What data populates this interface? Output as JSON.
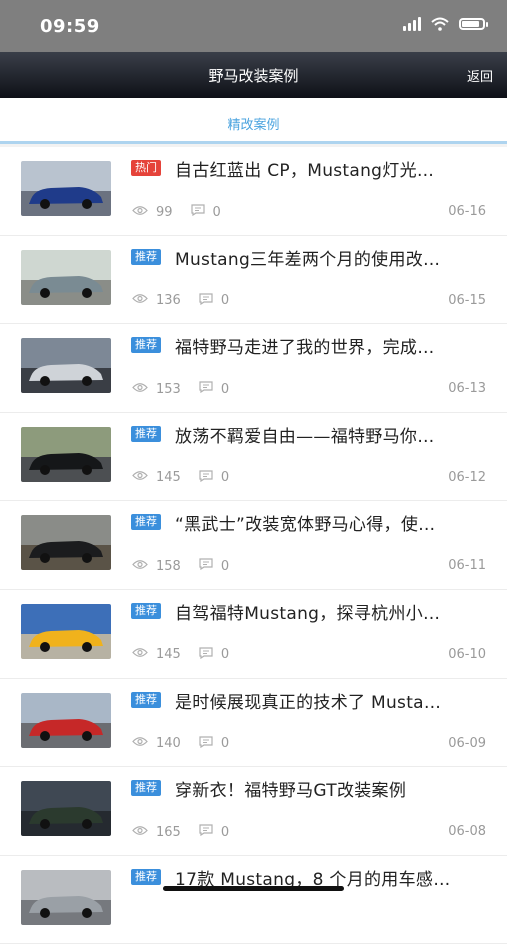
{
  "status": {
    "time": "09:59",
    "battery_level": 0.85
  },
  "nav": {
    "title": "野马改装案例",
    "back_label": "返回"
  },
  "tabs": [
    {
      "label": "精改案例",
      "active": true
    }
  ],
  "colors": {
    "hot": "#e5433a",
    "recommend": "#3b8fdc",
    "accent": "#4aa3df"
  },
  "items": [
    {
      "badge": "热门",
      "badge_type": "hot",
      "title": "自古红蓝出 CP，Mustang灯光…",
      "views": "99",
      "comments": "0",
      "date": "06-16"
    },
    {
      "badge": "推荐",
      "badge_type": "recommend",
      "title": "Mustang三年差两个月的使用改…",
      "views": "136",
      "comments": "0",
      "date": "06-15"
    },
    {
      "badge": "推荐",
      "badge_type": "recommend",
      "title": "福特野马走进了我的世界，完成…",
      "views": "153",
      "comments": "0",
      "date": "06-13"
    },
    {
      "badge": "推荐",
      "badge_type": "recommend",
      "title": "放荡不羁爱自由——福特野马你…",
      "views": "145",
      "comments": "0",
      "date": "06-12"
    },
    {
      "badge": "推荐",
      "badge_type": "recommend",
      "title": "“黑武士”改装宽体野马心得，使…",
      "views": "158",
      "comments": "0",
      "date": "06-11"
    },
    {
      "badge": "推荐",
      "badge_type": "recommend",
      "title": "自驾福特Mustang，探寻杭州小…",
      "views": "145",
      "comments": "0",
      "date": "06-10"
    },
    {
      "badge": "推荐",
      "badge_type": "recommend",
      "title": "是时候展现真正的技术了 Musta…",
      "views": "140",
      "comments": "0",
      "date": "06-09"
    },
    {
      "badge": "推荐",
      "badge_type": "recommend",
      "title": "穿新衣！福特野马GT改装案例",
      "views": "165",
      "comments": "0",
      "date": "06-08"
    },
    {
      "badge": "推荐",
      "badge_type": "recommend",
      "title": "17款 Mustang，8 个月的用车感…",
      "views": "",
      "comments": "",
      "date": ""
    }
  ]
}
